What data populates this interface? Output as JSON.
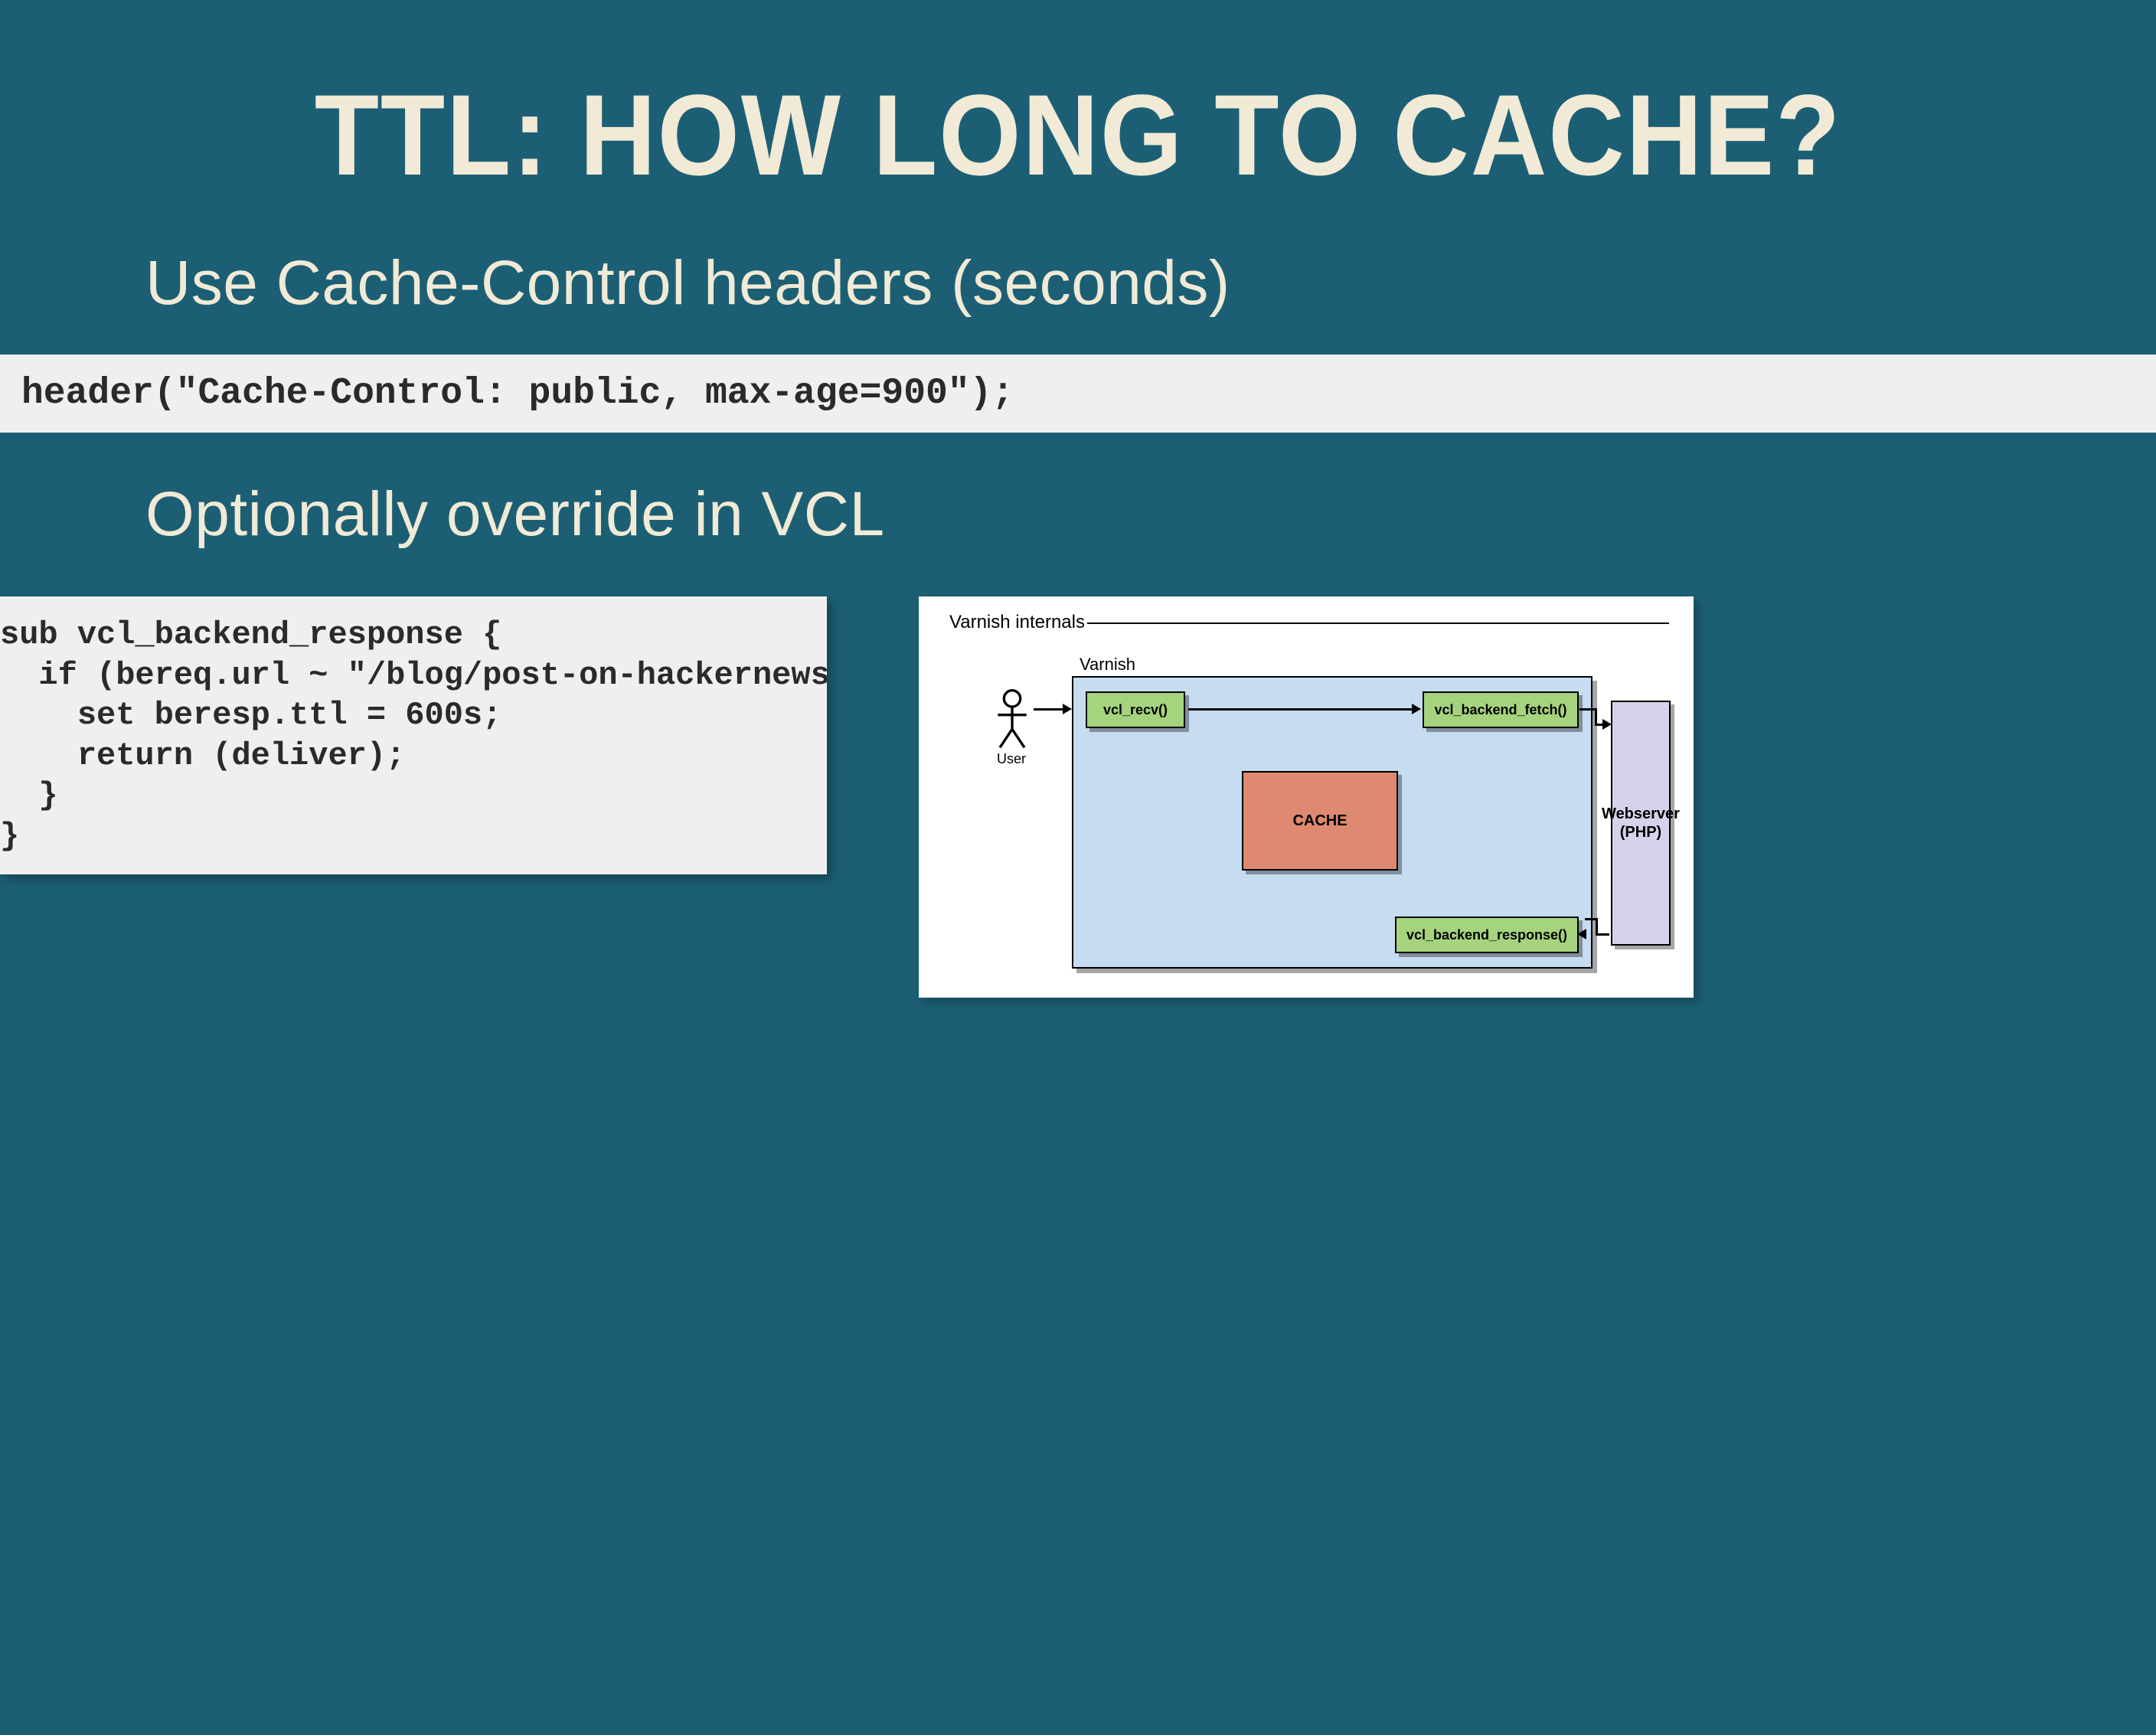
{
  "title": "TTL: HOW LONG TO CACHE?",
  "subhead1": "Use Cache-Control headers (seconds)",
  "code_bar": "header(\"Cache-Control: public, max-age=900\");",
  "subhead2": "Optionally override in VCL",
  "code_box": "sub vcl_backend_response {\n  if (bereq.url ~ \"/blog/post-on-hackernews\")\n    set beresp.ttl = 600s;\n    return (deliver);\n  }\n}",
  "diagram": {
    "title": "Varnish internals",
    "container_label": "Varnish",
    "actor_label": "User",
    "nodes": {
      "vcl_recv": "vcl_recv()",
      "vcl_backend_fetch": "vcl_backend_fetch()",
      "cache": "CACHE",
      "vcl_backend_response": "vcl_backend_response()",
      "webserver_line1": "Webserver",
      "webserver_line2": "(PHP)"
    }
  },
  "colors": {
    "background": "#1c5f74",
    "heading": "#f0ead6",
    "code_bg": "#efefef",
    "varnish_bg": "#c6dcf0",
    "node_green": "#a6d37e",
    "node_red": "#df8870",
    "node_purple": "#d7d2ea"
  }
}
